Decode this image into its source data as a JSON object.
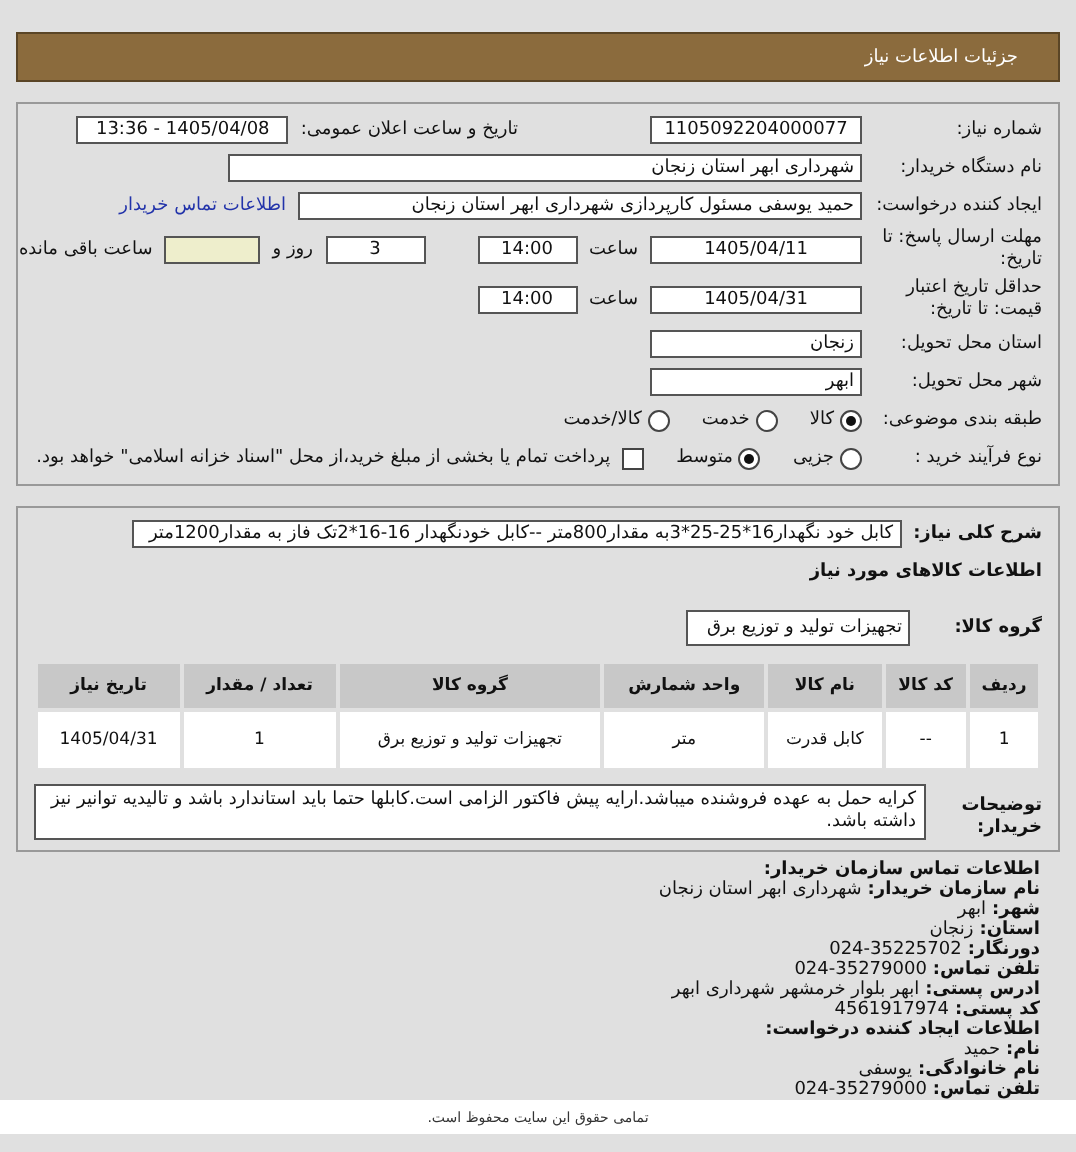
{
  "header": {
    "title": "جزئیات اطلاعات نیاز"
  },
  "need_number": {
    "label": "شماره نیاز:",
    "value": "1105092204000077"
  },
  "announce": {
    "label": "تاریخ و ساعت اعلان عمومی:",
    "value": "1405/04/08 - 13:36"
  },
  "buyer": {
    "label": "نام دستگاه خریدار:",
    "value": "شهرداری ابهر استان زنجان"
  },
  "requester": {
    "label": "ایجاد کننده درخواست:",
    "value": "حمید یوسفی مسئول کارپردازی شهرداری ابهر استان زنجان",
    "link": "اطلاعات تماس خریدار"
  },
  "deadline": {
    "label": "مهلت ارسال پاسخ: تا تاریخ:",
    "date": "1405/04/11",
    "time_label": "ساعت",
    "time": "14:00",
    "days": "3",
    "days_label": "روز و",
    "remaining_label": "ساعت باقی مانده"
  },
  "validity": {
    "label": "حداقل تاریخ اعتبار قیمت: تا تاریخ:",
    "date": "1405/04/31",
    "time_label": "ساعت",
    "time": "14:00"
  },
  "province": {
    "label": "استان محل تحویل:",
    "value": "زنجان"
  },
  "city": {
    "label": "شهر محل تحویل:",
    "value": "ابهر"
  },
  "category": {
    "label": "طبقه بندی موضوعی:",
    "options": [
      {
        "label": "کالا",
        "selected": true
      },
      {
        "label": "خدمت",
        "selected": false
      },
      {
        "label": "کالا/خدمت",
        "selected": false
      }
    ]
  },
  "purchase_type": {
    "label": "نوع فرآیند خرید :",
    "options": [
      {
        "label": "جزیی",
        "selected": false
      },
      {
        "label": "متوسط",
        "selected": true
      }
    ],
    "treasury": {
      "checked": false,
      "label": "پرداخت تمام یا بخشی از مبلغ خرید،از محل \"اسناد خزانه اسلامی\" خواهد بود."
    }
  },
  "description": {
    "label": "شرح کلی نیاز:",
    "value": "کابل خود نگهدار16*25-25*3به مقدار800متر --کابل خودنگهدار 16-16*2تک فاز به مقدار1200متر"
  },
  "goods": {
    "title": "اطلاعات کالاهای مورد نیاز",
    "group_label": "گروه کالا:",
    "group_value": "تجهیزات تولید و توزیع برق",
    "columns": [
      "ردیف",
      "کد کالا",
      "نام کالا",
      "واحد شمارش",
      "گروه کالا",
      "تعداد / مقدار",
      "تاریخ نیاز"
    ],
    "rows": [
      [
        "1",
        "--",
        "کابل قدرت",
        "متر",
        "تجهیزات تولید و توزیع برق",
        "1",
        "1405/04/31"
      ]
    ]
  },
  "notes": {
    "label": "توضیحات خریدار:",
    "value": "کرایه حمل به عهده فروشنده میباشد.ارایه پیش فاکتور الزامی است.کابلها حتما باید استاندارد باشد و تالیدیه توانیر نیز داشته باشد."
  },
  "contact": [
    {
      "kind": "heading",
      "label": "اطلاعات تماس سازمان خریدار:"
    },
    {
      "kind": "field",
      "label": "نام سازمان خریدار:",
      "value": "شهرداری ابهر استان زنجان"
    },
    {
      "kind": "field",
      "label": "شهر:",
      "value": "ابهر"
    },
    {
      "kind": "field",
      "label": "استان:",
      "value": "زنجان"
    },
    {
      "kind": "field",
      "label": "دورنگار:",
      "value": "024-35225702"
    },
    {
      "kind": "field",
      "label": "تلفن تماس:",
      "value": "024-35279000"
    },
    {
      "kind": "field",
      "label": "ادرس پستی:",
      "value": "ابهر بلوار خرمشهر شهرداری ابهر"
    },
    {
      "kind": "field",
      "label": "کد پستی:",
      "value": "4561917974"
    },
    {
      "kind": "heading",
      "label": "اطلاعات ایجاد کننده درخواست:"
    },
    {
      "kind": "field",
      "label": "نام:",
      "value": "حمید"
    },
    {
      "kind": "field",
      "label": "نام خانوادگی:",
      "value": "یوسفی"
    },
    {
      "kind": "field",
      "label": "تلفن تماس:",
      "value": "024-35279000"
    }
  ],
  "footer": {
    "text": "تمامی حقوق این سایت محفوظ است."
  }
}
